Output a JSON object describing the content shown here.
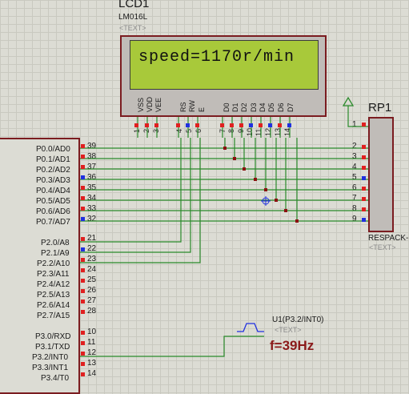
{
  "lcd": {
    "name": "LCD1",
    "model": "LM016L",
    "text_tag": "<TEXT>",
    "display": "speed=1170r/min",
    "control_pins": [
      {
        "name": "VSS",
        "num": "1"
      },
      {
        "name": "VDD",
        "num": "2"
      },
      {
        "name": "VEE",
        "num": "3"
      },
      {
        "name": "RS",
        "num": "4"
      },
      {
        "name": "RW",
        "num": "5"
      },
      {
        "name": "E",
        "num": "6"
      }
    ],
    "data_pins": [
      {
        "name": "D0",
        "num": "7"
      },
      {
        "name": "D1",
        "num": "8"
      },
      {
        "name": "D2",
        "num": "9"
      },
      {
        "name": "D3",
        "num": "10"
      },
      {
        "name": "D4",
        "num": "11"
      },
      {
        "name": "D5",
        "num": "12"
      },
      {
        "name": "D6",
        "num": "13"
      },
      {
        "name": "D7",
        "num": "14"
      }
    ]
  },
  "mcu": {
    "port0": [
      {
        "label": "P0.0/AD0",
        "num": "39"
      },
      {
        "label": "P0.1/AD1",
        "num": "38"
      },
      {
        "label": "P0.2/AD2",
        "num": "37"
      },
      {
        "label": "P0.3/AD3",
        "num": "36"
      },
      {
        "label": "P0.4/AD4",
        "num": "35"
      },
      {
        "label": "P0.5/AD5",
        "num": "34"
      },
      {
        "label": "P0.6/AD6",
        "num": "33"
      },
      {
        "label": "P0.7/AD7",
        "num": "32"
      }
    ],
    "port2": [
      {
        "label": "P2.0/A8",
        "num": "21"
      },
      {
        "label": "P2.1/A9",
        "num": "22"
      },
      {
        "label": "P2.2/A10",
        "num": "23"
      },
      {
        "label": "P2.3/A11",
        "num": "24"
      },
      {
        "label": "P2.4/A12",
        "num": "25"
      },
      {
        "label": "P2.5/A13",
        "num": "26"
      },
      {
        "label": "P2.6/A14",
        "num": "27"
      },
      {
        "label": "P2.7/A15",
        "num": "28"
      }
    ],
    "port3": [
      {
        "label": "P3.0/RXD",
        "num": "10"
      },
      {
        "label": "P3.1/TXD",
        "num": "11"
      },
      {
        "label": "P3.2/INT0",
        "num": "12"
      },
      {
        "label": "P3.3/INT1",
        "num": "13"
      },
      {
        "label": "P3.4/T0",
        "num": "14"
      }
    ]
  },
  "respack": {
    "name": "RP1",
    "model": "RESPACK-",
    "text_tag": "<TEXT>",
    "pins": [
      "1",
      "2",
      "3",
      "4",
      "5",
      "6",
      "7",
      "8",
      "9"
    ]
  },
  "probe": {
    "label": "U1(P3.2/INT0)",
    "text_tag": "<TEXT>",
    "frequency": "f=39Hz"
  },
  "colors": {
    "wire": "#2a8a2a",
    "component_border": "#7b1c20",
    "lcd_screen": "#a8c93a",
    "pin_red": "#e02020",
    "pin_blue": "#2030e0",
    "freq_text": "#8b1a1a",
    "junction": "#8b1010"
  }
}
